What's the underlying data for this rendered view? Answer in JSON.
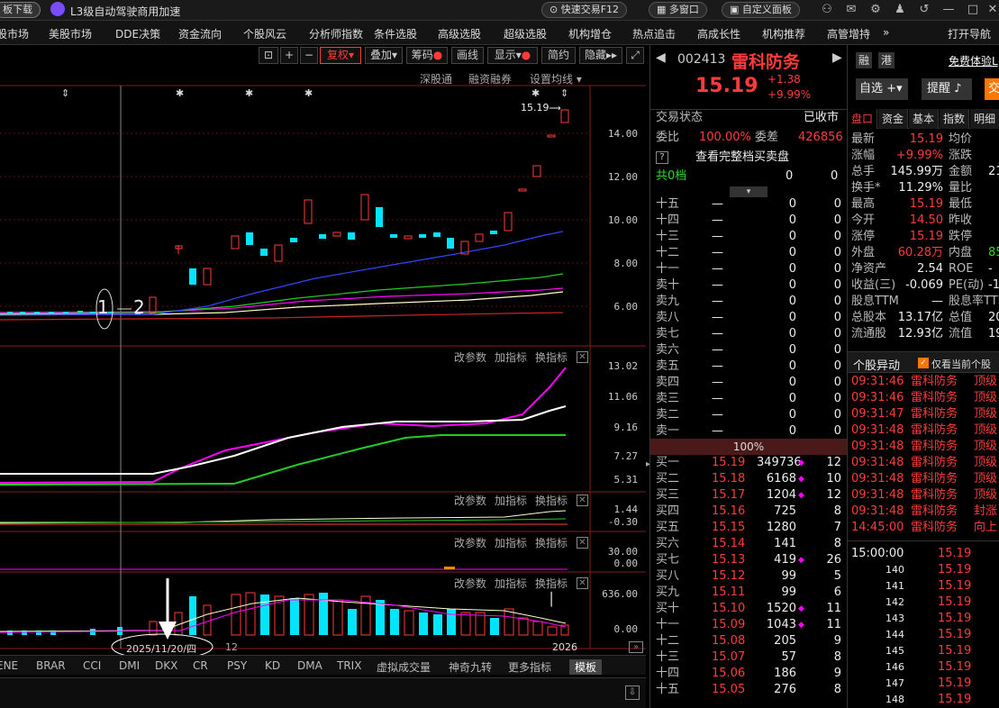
{
  "titlebar": {
    "left_label": "板下载",
    "promo": "L3级自动驾驶商用加速",
    "quick_trade": "快速交易F12",
    "multi_window": "多窗口",
    "custom_panel": "自定义面板"
  },
  "menu": [
    "股市场",
    "美股市场",
    "DDE决策",
    "资金流向",
    "个股风云",
    "分析师指数",
    "条件选股",
    "高级选股",
    "超级选股",
    "机构增仓",
    "热点追击",
    "高成长性",
    "机构推荐",
    "高管增持",
    "»",
    "打开导航"
  ],
  "toolbar": {
    "fuquan": "复权",
    "overlay": "叠加",
    "chips": "筹码",
    "draw_line": "画线",
    "display": "显示",
    "simple": "简约",
    "hide": "隐藏",
    "sub_links": [
      "深股通",
      "融资融券",
      "设置均线"
    ]
  },
  "main_chart": {
    "last_price_label": "15.19",
    "y_labels": [
      "14.00",
      "12.00",
      "10.00",
      "8.00",
      "6.00"
    ],
    "annotation_1": "1",
    "annotation_2": "2"
  },
  "subcharts": [
    {
      "controls": [
        "改参数",
        "加指标",
        "换指标"
      ],
      "y_labels": [
        "13.02",
        "11.06",
        "9.16",
        "7.27",
        "5.31"
      ]
    },
    {
      "controls": [
        "改参数",
        "加指标",
        "换指标"
      ],
      "y_labels": [
        "1.44",
        "-0.30"
      ]
    },
    {
      "controls": [
        "改参数",
        "加指标",
        "换指标"
      ],
      "y_labels": [
        "30.00",
        "0.00"
      ]
    },
    {
      "controls": [
        "改参数",
        "加指标",
        "换指标"
      ],
      "y_labels": [
        "636.00",
        "0.00"
      ]
    }
  ],
  "x_axis": {
    "date_label": "2025/11/20/四",
    "mid_label": "12",
    "right_label": "2026"
  },
  "indicators": [
    "ENE",
    "BRAR",
    "CCI",
    "DMI",
    "DKX",
    "CR",
    "PSY",
    "KD",
    "DMA",
    "TRIX",
    "虚拟成交量",
    "神奇九转",
    "更多指标",
    "模板"
  ],
  "stock": {
    "code": "002413",
    "name": "雷科防务",
    "price": "15.19",
    "change": "+1.38",
    "change_pct": "+9.99%",
    "tag_rong": "融",
    "tag_gang": "港",
    "free_trial": "免费体验L",
    "watch_btn": "自选",
    "alert_btn": "提醒",
    "trade_btn": "交"
  },
  "quote": {
    "trade_status_label": "交易状态",
    "trade_status": "已收市",
    "weibi_label": "委比",
    "weibi": "100.00%",
    "weicha_label": "委差",
    "weicha": "426856",
    "full_book": "查看完整档买卖盘",
    "total_label": "共0档",
    "total_a": "0",
    "total_b": "0",
    "upper_levels": [
      {
        "label": "十五",
        "price": "—",
        "vol": "0",
        "n": "0"
      },
      {
        "label": "十四",
        "price": "—",
        "vol": "0",
        "n": "0"
      },
      {
        "label": "十三",
        "price": "—",
        "vol": "0",
        "n": "0"
      },
      {
        "label": "十二",
        "price": "—",
        "vol": "0",
        "n": "0"
      },
      {
        "label": "十一",
        "price": "—",
        "vol": "0",
        "n": "0"
      },
      {
        "label": "卖十",
        "price": "—",
        "vol": "0",
        "n": "0"
      },
      {
        "label": "卖九",
        "price": "—",
        "vol": "0",
        "n": "0"
      },
      {
        "label": "卖八",
        "price": "—",
        "vol": "0",
        "n": "0"
      },
      {
        "label": "卖七",
        "price": "—",
        "vol": "0",
        "n": "0"
      },
      {
        "label": "卖六",
        "price": "—",
        "vol": "0",
        "n": "0"
      },
      {
        "label": "卖五",
        "price": "—",
        "vol": "0",
        "n": "0"
      },
      {
        "label": "卖四",
        "price": "—",
        "vol": "0",
        "n": "0"
      },
      {
        "label": "卖三",
        "price": "—",
        "vol": "0",
        "n": "0"
      },
      {
        "label": "卖二",
        "price": "—",
        "vol": "0",
        "n": "0"
      },
      {
        "label": "卖一",
        "price": "—",
        "vol": "0",
        "n": "0"
      }
    ],
    "mid_pct": "100%",
    "buy_levels": [
      {
        "label": "买一",
        "price": "15.19",
        "vol": "349736",
        "n": "12"
      },
      {
        "label": "买二",
        "price": "15.18",
        "vol": "6168",
        "n": "10"
      },
      {
        "label": "买三",
        "price": "15.17",
        "vol": "1204",
        "n": "12"
      },
      {
        "label": "买四",
        "price": "15.16",
        "vol": "725",
        "n": "8"
      },
      {
        "label": "买五",
        "price": "15.15",
        "vol": "1280",
        "n": "7"
      },
      {
        "label": "买六",
        "price": "15.14",
        "vol": "141",
        "n": "8"
      },
      {
        "label": "买七",
        "price": "15.13",
        "vol": "419",
        "n": "26"
      },
      {
        "label": "买八",
        "price": "15.12",
        "vol": "99",
        "n": "5"
      },
      {
        "label": "买九",
        "price": "15.11",
        "vol": "99",
        "n": "6"
      },
      {
        "label": "买十",
        "price": "15.10",
        "vol": "1520",
        "n": "11"
      },
      {
        "label": "十一",
        "price": "15.09",
        "vol": "1043",
        "n": "11"
      },
      {
        "label": "十二",
        "price": "15.08",
        "vol": "205",
        "n": "9"
      },
      {
        "label": "十三",
        "price": "15.07",
        "vol": "57",
        "n": "8"
      },
      {
        "label": "十四",
        "price": "15.06",
        "vol": "186",
        "n": "9"
      },
      {
        "label": "十五",
        "price": "15.05",
        "vol": "276",
        "n": "8"
      }
    ]
  },
  "info_tabs": [
    "盘口",
    "资金",
    "基本",
    "指数",
    "明细"
  ],
  "info_rows": [
    {
      "l1": "最新",
      "v1": "15.19",
      "l2": "均价",
      "v2": "",
      "c": "red"
    },
    {
      "l1": "涨幅",
      "v1": "+9.99%",
      "l2": "涨跌",
      "v2": "",
      "c": "red"
    },
    {
      "l1": "总手",
      "v1": "145.99万",
      "l2": "金额",
      "v2": "21",
      "c": "white"
    },
    {
      "l1": "换手*",
      "v1": "11.29%",
      "l2": "量比",
      "v2": "",
      "c": "white"
    },
    {
      "l1": "最高",
      "v1": "15.19",
      "l2": "最低",
      "v2": "",
      "c": "red"
    },
    {
      "l1": "今开",
      "v1": "14.50",
      "l2": "昨收",
      "v2": "",
      "c": "red"
    },
    {
      "l1": "涨停",
      "v1": "15.19",
      "l2": "跌停",
      "v2": "",
      "c": "red"
    },
    {
      "l1": "外盘",
      "v1": "60.28万",
      "l2": "内盘",
      "v2": "85",
      "c": "red"
    },
    {
      "l1": "净资产",
      "v1": "2.54",
      "l2": "ROE",
      "v2": "-",
      "c": "white"
    },
    {
      "l1": "收益(三)",
      "v1": "-0.069",
      "l2": "PE(动)",
      "v2": "-1",
      "c": "white"
    },
    {
      "l1": "股息TTM",
      "v1": "—",
      "l2": "股息率TTM",
      "v2": "",
      "c": "white"
    },
    {
      "l1": "总股本",
      "v1": "13.17亿",
      "l2": "总值",
      "v2": "20",
      "c": "white"
    },
    {
      "l1": "流通股",
      "v1": "12.93亿",
      "l2": "流值",
      "v2": "19",
      "c": "white"
    }
  ],
  "alerts": {
    "title": "个股异动",
    "only_current": "仅看当前个股",
    "items": [
      {
        "time": "09:31:46",
        "name": "雷科防务",
        "type": "顶级"
      },
      {
        "time": "09:31:46",
        "name": "雷科防务",
        "type": "顶级"
      },
      {
        "time": "09:31:47",
        "name": "雷科防务",
        "type": "顶级"
      },
      {
        "time": "09:31:48",
        "name": "雷科防务",
        "type": "顶级"
      },
      {
        "time": "09:31:48",
        "name": "雷科防务",
        "type": "顶级"
      },
      {
        "time": "09:31:48",
        "name": "雷科防务",
        "type": "顶级"
      },
      {
        "time": "09:31:48",
        "name": "雷科防务",
        "type": "顶级"
      },
      {
        "time": "09:31:48",
        "name": "雷科防务",
        "type": "顶级"
      },
      {
        "time": "09:31:48",
        "name": "雷科防务",
        "type": "封涨"
      },
      {
        "time": "14:45:00",
        "name": "雷科防务",
        "type": "向上"
      }
    ]
  },
  "ticks": [
    {
      "t": "15:00:00",
      "p": "15.19"
    },
    {
      "t": "140",
      "p": "15.19"
    },
    {
      "t": "141",
      "p": "15.19"
    },
    {
      "t": "142",
      "p": "15.19"
    },
    {
      "t": "143",
      "p": "15.19"
    },
    {
      "t": "144",
      "p": "15.19"
    },
    {
      "t": "145",
      "p": "15.19"
    },
    {
      "t": "146",
      "p": "15.19"
    },
    {
      "t": "147",
      "p": "15.19"
    },
    {
      "t": "148",
      "p": "15.19"
    }
  ]
}
